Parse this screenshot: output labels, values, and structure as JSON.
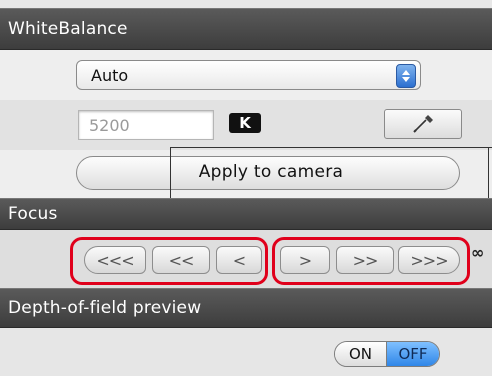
{
  "white_balance": {
    "header": "WhiteBalance",
    "mode_selected": "Auto",
    "kelvin_value": "5200",
    "kelvin_unit": "K",
    "eyedropper_icon": "eyedropper-icon",
    "apply_label": "Apply to camera"
  },
  "focus": {
    "header": "Focus",
    "buttons": [
      "<<<",
      "<<",
      "<",
      ">",
      ">>",
      ">>>"
    ],
    "infinity_symbol": "∞"
  },
  "depth_of_field": {
    "header": "Depth-of-field preview",
    "on_label": "ON",
    "off_label": "OFF",
    "selected": "OFF"
  },
  "colors": {
    "header_bg": "#4a4a4a",
    "highlight_outline": "#e0001b",
    "accent_blue": "#2f86e8"
  }
}
